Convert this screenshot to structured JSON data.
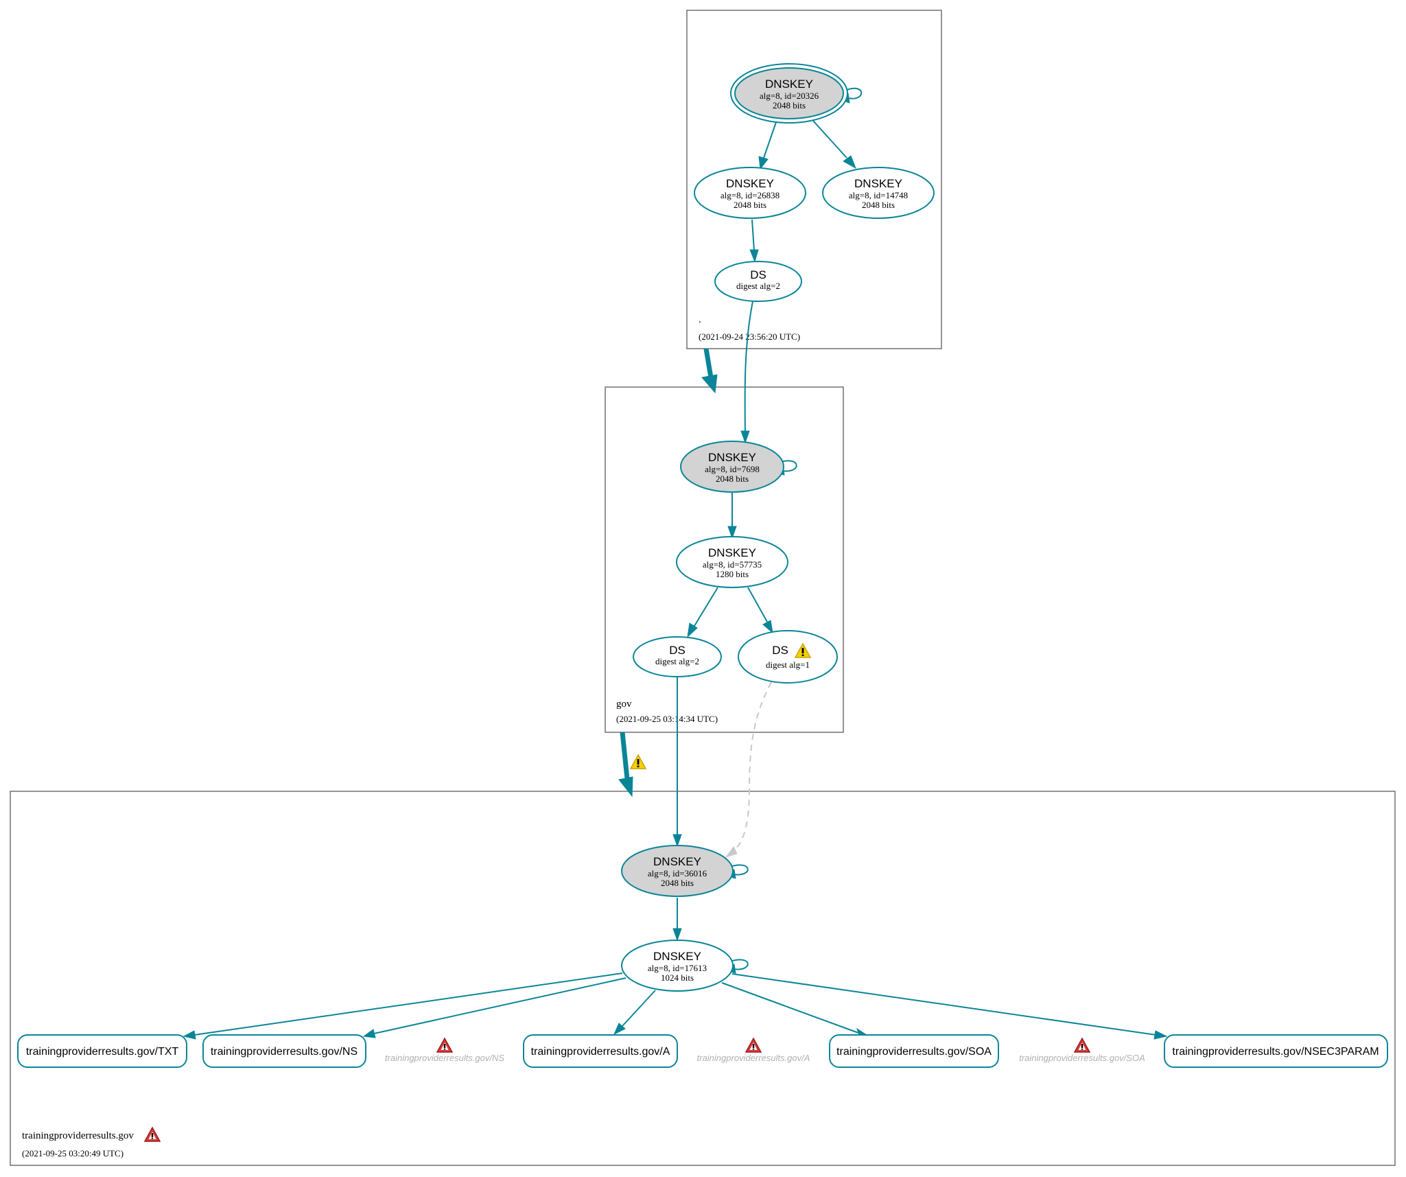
{
  "colors": {
    "edge": "#0a8598",
    "ksk_fill": "#d3d3d3",
    "invalid_edge": "#c8c8c8",
    "warning_yellow": "#f2c500",
    "error_red": "#d42a2a"
  },
  "zones": {
    "root": {
      "name": ".",
      "timestamp": "(2021-09-24 23:56:20 UTC)",
      "nodes": {
        "ksk": {
          "type": "DNSKEY",
          "detail": "alg=8, id=20326",
          "size": "2048 bits",
          "role": "trust-anchor KSK"
        },
        "zsk1": {
          "type": "DNSKEY",
          "detail": "alg=8, id=26838",
          "size": "2048 bits"
        },
        "zsk2": {
          "type": "DNSKEY",
          "detail": "alg=8, id=14748",
          "size": "2048 bits"
        },
        "ds": {
          "type": "DS",
          "detail": "digest alg=2"
        }
      }
    },
    "gov": {
      "name": "gov",
      "timestamp": "(2021-09-25 03:14:34 UTC)",
      "nodes": {
        "ksk": {
          "type": "DNSKEY",
          "detail": "alg=8, id=7698",
          "size": "2048 bits"
        },
        "zsk": {
          "type": "DNSKEY",
          "detail": "alg=8, id=57735",
          "size": "1280 bits"
        },
        "ds2": {
          "type": "DS",
          "detail": "digest alg=2"
        },
        "ds1": {
          "type": "DS",
          "detail": "digest alg=1",
          "status": "warning"
        }
      },
      "delegation_status": "warning"
    },
    "domain": {
      "name": "trainingproviderresults.gov",
      "timestamp": "(2021-09-25 03:20:49 UTC)",
      "status": "error",
      "nodes": {
        "ksk": {
          "type": "DNSKEY",
          "detail": "alg=8, id=36016",
          "size": "2048 bits"
        },
        "zsk": {
          "type": "DNSKEY",
          "detail": "alg=8, id=17613",
          "size": "1024 bits"
        }
      },
      "rrsets": [
        {
          "label": "trainingproviderresults.gov/TXT"
        },
        {
          "label": "trainingproviderresults.gov/NS"
        },
        {
          "label": "trainingproviderresults.gov/A"
        },
        {
          "label": "trainingproviderresults.gov/SOA"
        },
        {
          "label": "trainingproviderresults.gov/NSEC3PARAM"
        }
      ],
      "errors": [
        {
          "label": "trainingproviderresults.gov/NS"
        },
        {
          "label": "trainingproviderresults.gov/A"
        },
        {
          "label": "trainingproviderresults.gov/SOA"
        }
      ]
    }
  }
}
